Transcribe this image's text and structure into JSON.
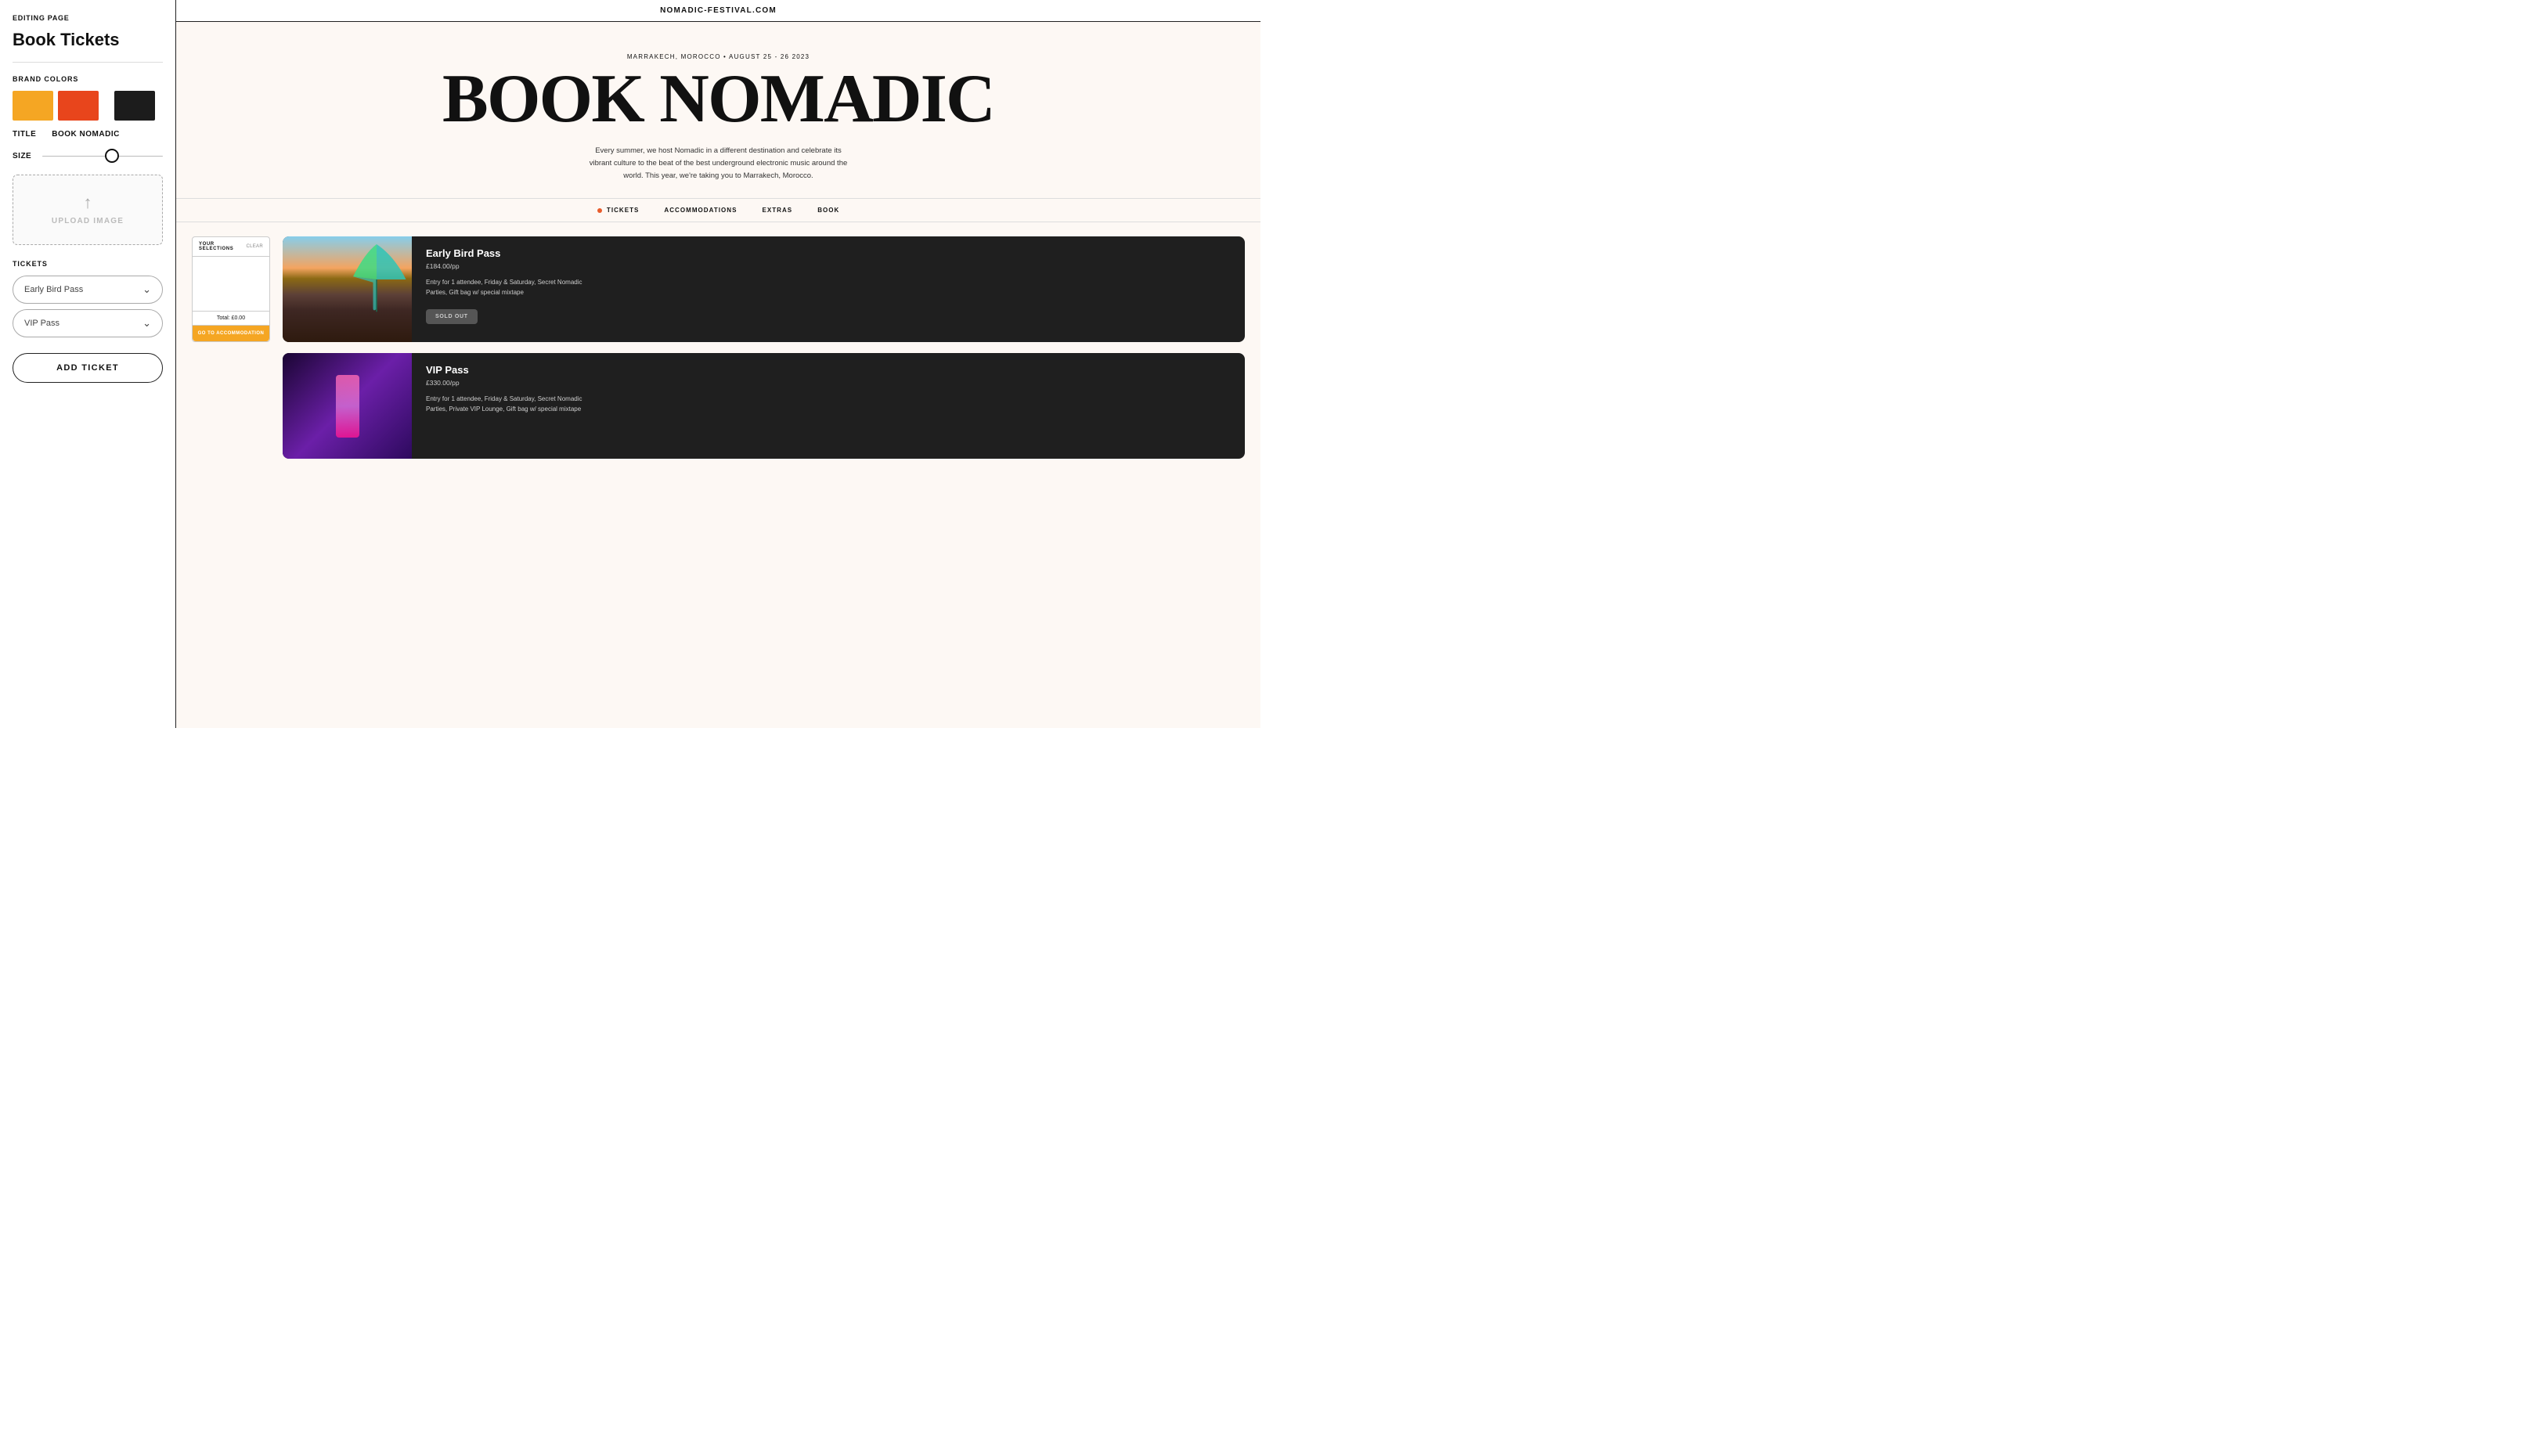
{
  "leftPanel": {
    "editingLabel": "EDITING PAGE",
    "pageTitle": "Book Tickets",
    "brandColorsLabel": "BRAND COLORS",
    "colors": {
      "yellow": "#F5A623",
      "orange": "#E8451C",
      "black": "#1C1C1C"
    },
    "titleLabel": "TITLE",
    "titleValue": "BOOK NOMADIC",
    "sizeLabel": "SIZE",
    "uploadText": "UPLOAD IMAGE",
    "ticketsLabel": "TICKETS",
    "tickets": [
      {
        "label": "Early Bird Pass"
      },
      {
        "label": "VIP Pass"
      }
    ],
    "addTicketLabel": "ADD TICKET"
  },
  "rightPanel": {
    "domainBar": "NOMADIC-FESTIVAL.COM",
    "hero": {
      "subtitle": "MARRAKECH, MOROCCO • AUGUST 25 - 26 2023",
      "title": "BOOK NOMADIC",
      "description": "Every summer, we host Nomadic in a different destination and celebrate its vibrant culture to the beat of the best underground electronic music around the world. This year, we're taking you to Marrakech, Morocco."
    },
    "nav": [
      {
        "label": "TICKETS",
        "active": true
      },
      {
        "label": "ACCOMMODATIONS"
      },
      {
        "label": "EXTRAS"
      },
      {
        "label": "BOOK"
      }
    ],
    "selections": {
      "title": "YOUR SELECTIONS",
      "clearLabel": "CLEAR",
      "total": "Total: £0.00",
      "goToAccommodation": "GO TO ACCOMMODATION"
    },
    "ticketCards": [
      {
        "name": "Early Bird Pass",
        "price": "£184.00/pp",
        "description": "Entry for 1 attendee, Friday & Saturday, Secret Nomadic Parties, Gift bag w/ special mixtape",
        "status": "SOLD OUT",
        "imageType": "crowd"
      },
      {
        "name": "VIP Pass",
        "price": "£330.00/pp",
        "description": "Entry for 1 attendee, Friday & Saturday, Secret Nomadic Parties, Private VIP Lounge, Gift bag w/ special mixtape",
        "status": null,
        "imageType": "neon"
      }
    ]
  }
}
